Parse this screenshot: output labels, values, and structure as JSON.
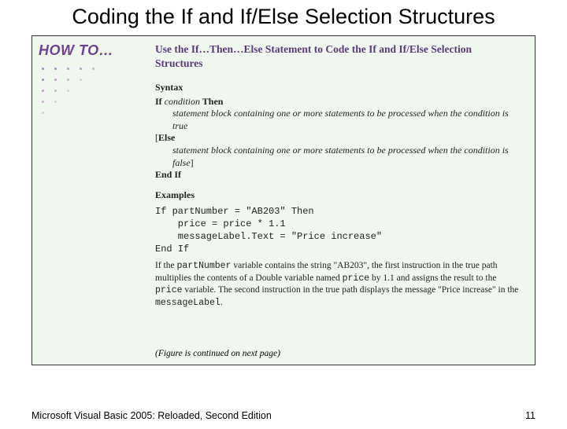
{
  "title": "Coding the If and If/Else Selection Structures",
  "howto_label": "HOW TO…",
  "box_title": "Use the If…Then…Else Statement to Code the If and If/Else Selection Structures",
  "syntax": {
    "heading": "Syntax",
    "line1_a": "If ",
    "line1_b": "condition",
    "line1_c": " Then",
    "line2": "statement block containing one or more statements to be processed when the condition is true",
    "line3_a": "[",
    "line3_b": "Else",
    "line4": "statement block containing one or more statements to be processed when the condition is false",
    "line4_end": "]",
    "line5": "End If"
  },
  "examples": {
    "heading": "Examples",
    "code": "If partNumber = \"AB203\" Then\n    price = price * 1.1\n    messageLabel.Text = \"Price increase\"\nEnd If",
    "explain_parts": {
      "t1": "If the ",
      "m1": "partNumber",
      "t2": " variable contains the string \"AB203\", the first instruction in the true path multiplies the contents of a Double variable named ",
      "m2": "price",
      "t3": " by 1.1 and assigns the result to the ",
      "m3": "price",
      "t4": " variable. The second instruction in the true path displays the message \"Price increase\" in the ",
      "m4": "messageLabel",
      "t5": "."
    }
  },
  "continued": "(Figure is continued on next page)",
  "footer_left": "Microsoft Visual Basic 2005: Reloaded, Second Edition",
  "footer_right": "11"
}
